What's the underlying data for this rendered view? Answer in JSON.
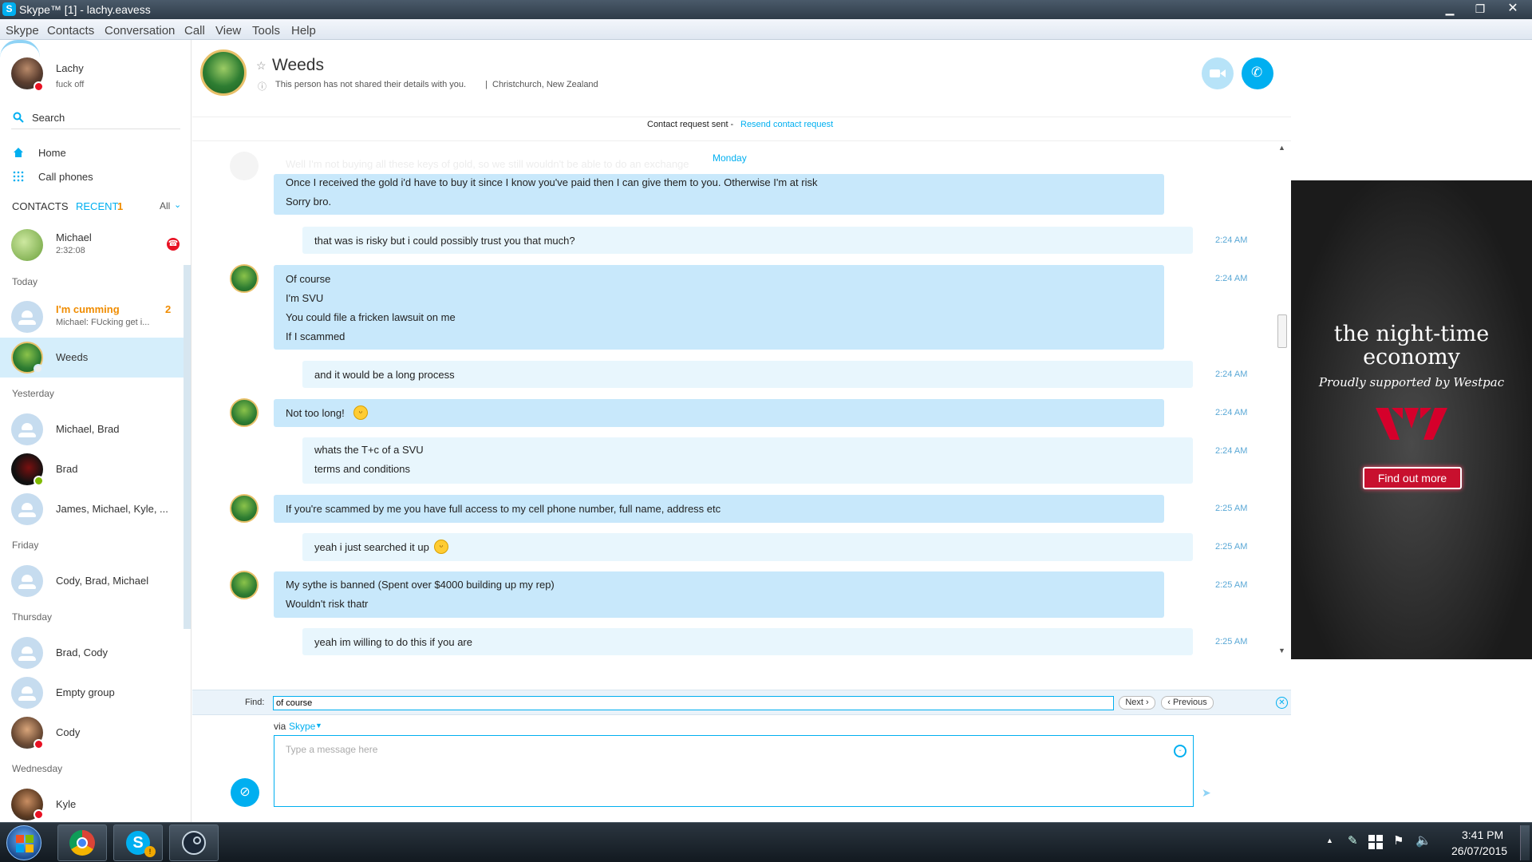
{
  "window": {
    "title": "Skype™ [1] - lachy.eavess",
    "logo_letter": "S"
  },
  "menu": [
    "Skype",
    "Contacts",
    "Conversation",
    "Call",
    "View",
    "Tools",
    "Help"
  ],
  "profile": {
    "name": "Lachy",
    "mood": "fuck off"
  },
  "search_label": "Search",
  "nav": {
    "home": "Home",
    "call_phones": "Call phones"
  },
  "tabs": {
    "contacts": "CONTACTS",
    "recent": "RECENT",
    "recent_count": "1",
    "filter": "All"
  },
  "recent": {
    "michael": {
      "name": "Michael",
      "sub": "2:32:08"
    },
    "today": "Today",
    "im_cumming": {
      "name": "I'm cumming",
      "sub": "Michael: FUcking get i...",
      "count": "2"
    },
    "weeds": {
      "name": "Weeds"
    },
    "yesterday": "Yesterday",
    "michael_brad": {
      "name": "Michael, Brad"
    },
    "brad": {
      "name": "Brad"
    },
    "james": {
      "name": "James, Michael, Kyle, ..."
    },
    "friday": "Friday",
    "cody_brad_michael": {
      "name": "Cody, Brad, Michael"
    },
    "thursday": "Thursday",
    "brad_cody": {
      "name": "Brad, Cody"
    },
    "empty_group": {
      "name": "Empty group"
    },
    "cody": {
      "name": "Cody"
    },
    "wednesday": "Wednesday",
    "kyle": {
      "name": "Kyle"
    }
  },
  "conversation": {
    "name": "Weeds",
    "details": "This person has not shared their details with you.",
    "location": "Christchurch, New Zealand",
    "request_text": "Contact request sent - ",
    "request_link": "Resend contact request",
    "day": "Monday",
    "faded_line": "Well I'm not buying all these keys of gold, so we still wouldn't be able to do an exchange"
  },
  "messages": {
    "m1": {
      "lines": [
        "Once I received the gold i'd have to buy it since I know you've paid then I can give them to you. Otherwise I'm at risk",
        "Sorry bro."
      ]
    },
    "m2": {
      "lines": [
        "that was is risky but i could possibly trust you that much?"
      ],
      "time": "2:24 AM"
    },
    "m3": {
      "lines": [
        "Of course",
        "I'm SVU",
        "You could file a fricken lawsuit on me",
        "If I scammed"
      ],
      "time": "2:24 AM"
    },
    "m4": {
      "lines": [
        "and it would be a long process"
      ],
      "time": "2:24 AM"
    },
    "m5": {
      "lines": [
        "Not too long!"
      ],
      "time": "2:24 AM"
    },
    "m6": {
      "lines": [
        "whats the T+c of a SVU",
        "terms and conditions"
      ],
      "time": "2:24 AM"
    },
    "m7": {
      "lines": [
        "If you're scammed by me you have full access to my cell phone number, full name, address etc"
      ],
      "time": "2:25 AM"
    },
    "m8": {
      "lines": [
        "yeah i just searched it up"
      ],
      "time": "2:25 AM"
    },
    "m9": {
      "lines": [
        "My sythe is banned (Spent over $4000 building up my rep)",
        "Wouldn't risk thatr"
      ],
      "time": "2:25 AM"
    },
    "m10": {
      "lines": [
        "yeah im willing to do this if you are"
      ],
      "time": "2:25 AM"
    }
  },
  "find": {
    "label": "Find:",
    "value": "of course",
    "next": "Next",
    "previous": "Previous"
  },
  "compose": {
    "via": "via ",
    "via_link": "Skype",
    "placeholder": "Type a message here"
  },
  "ad": {
    "headline1": "the night-time",
    "headline2": "economy",
    "tagline": "Proudly supported by Westpac",
    "button": "Find out more"
  },
  "taskbar": {
    "time": "3:41 PM",
    "date": "26/07/2015"
  },
  "colors": {
    "accent": "#00aff0",
    "bubble_in": "#c8e8fb",
    "bubble_out": "#e8f6fd",
    "unread": "#f08c00"
  }
}
